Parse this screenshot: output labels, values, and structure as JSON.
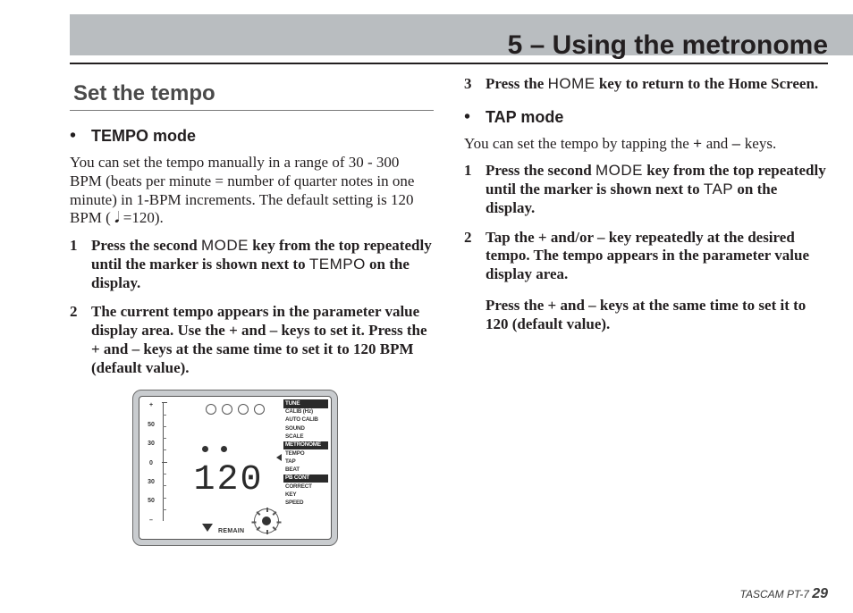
{
  "chapter": "5 – Using the metronome",
  "section": "Set the tempo",
  "tempo_mode": {
    "heading": "TEMPO mode",
    "lead": "You can set the tempo manually in a range of 30 - 300 BPM (beats per minute = number of quarter notes in one minute) in 1-BPM increments. The default setting is 120 BPM ( 𝅘𝅥 =120).",
    "steps": {
      "s1a": "Press the second ",
      "s1_key": "MODE",
      "s1b": " key from the top repeatedly until the marker is shown next to ",
      "s1_key2": "TEMPO",
      "s1c": " on the display.",
      "s2": "The current tempo appears in the parameter value display area. Use the + and – keys to set it. Press the + and – keys at the same time to set it to 120 BPM (default value).",
      "s3a": "Press the ",
      "s3_key": "HOME",
      "s3b": " key to return to the Home Screen."
    }
  },
  "tap_mode": {
    "heading": "TAP mode",
    "lead_a": "You can set the tempo by tapping the ",
    "lead_plus": "+",
    "lead_mid": " and ",
    "lead_minus": "–",
    "lead_b": " keys.",
    "steps": {
      "s1a": "Press the second ",
      "s1_key": "MODE",
      "s1b": " key from the top repeatedly until the marker is shown next to ",
      "s1_key2": "TAP",
      "s1c": " on the display.",
      "s2": "Tap the + and/or – key repeatedly at the desired tempo. The tempo appears in the parameter value display area.",
      "note": "Press the + and – keys at the same time to set it to 120 (default value)."
    }
  },
  "lcd": {
    "value": "120",
    "remain": "REMAIN",
    "scale": {
      "p50": "50",
      "p30": "30",
      "zero": "0",
      "m30": "30",
      "m50": "50",
      "plus": "+",
      "minus": "–"
    },
    "menu": [
      "TUNE",
      "CALIB (Hz)",
      "AUTO CALIB",
      "SOUND",
      "SCALE",
      "METRONOME",
      "TEMPO",
      "TAP",
      "BEAT",
      "PB CONT",
      "CORRECT",
      "KEY",
      "SPEED"
    ],
    "menu_inverted": [
      0,
      5,
      9
    ]
  },
  "footer": {
    "brand": "TASCAM  PT-7 ",
    "page": "29"
  }
}
